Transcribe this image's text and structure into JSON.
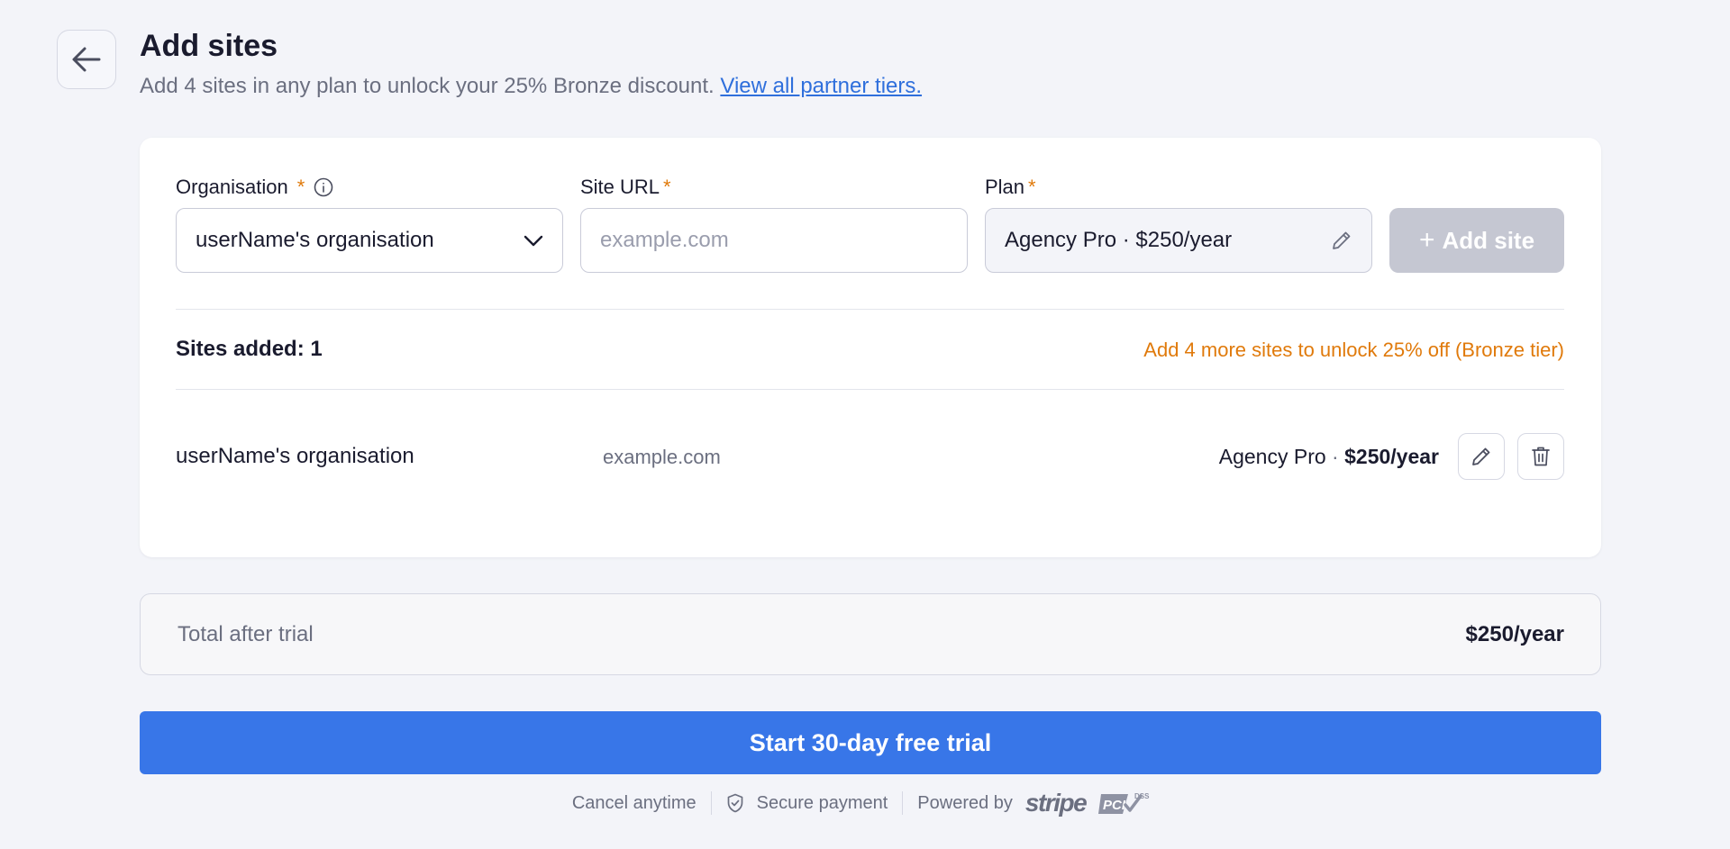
{
  "header": {
    "title": "Add sites",
    "subtitle": "Add 4 sites in any plan to unlock your 25% Bronze discount.",
    "tiers_link": "View all partner tiers.",
    "back_icon": "arrow-left-icon"
  },
  "form": {
    "organisation_label": "Organisation",
    "organisation_value": "userName's organisation",
    "site_url_label": "Site URL",
    "site_url_placeholder": "example.com",
    "plan_label": "Plan",
    "plan_value": "Agency Pro · $250/year",
    "required_marker": "*",
    "add_site_label": "Add site"
  },
  "summary": {
    "sites_added": "Sites added: 1",
    "discount_hint": "Add 4 more sites to unlock 25% off (Bronze tier)"
  },
  "sites": [
    {
      "organisation": "userName's organisation",
      "url": "example.com",
      "plan_name": "Agency Pro",
      "separator": "·",
      "price": "$250/year"
    }
  ],
  "total": {
    "label": "Total after trial",
    "value": "$250/year"
  },
  "cta": {
    "label": "Start 30-day free trial"
  },
  "footer": {
    "cancel": "Cancel anytime",
    "secure": "Secure payment",
    "powered_by": "Powered by",
    "stripe": "stripe",
    "pci": "PCI",
    "dss": "DSS"
  },
  "colors": {
    "accent": "#3876e8",
    "warning": "#e07a0b",
    "link": "#2f6fdc",
    "disabled_button": "#c5c7d2",
    "background": "#f3f4f9"
  }
}
